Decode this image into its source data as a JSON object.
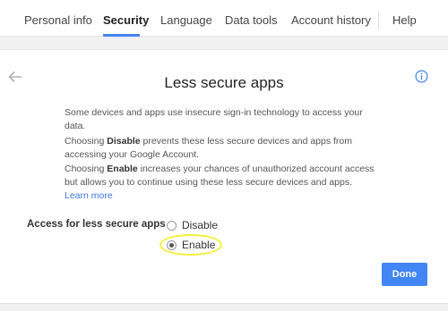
{
  "tabs": [
    {
      "label": "Personal info",
      "active": false
    },
    {
      "label": "Security",
      "active": true
    },
    {
      "label": "Language",
      "active": false
    },
    {
      "label": "Data tools",
      "active": false
    },
    {
      "label": "Account history",
      "active": false
    },
    {
      "label": "Help",
      "active": false
    }
  ],
  "accent_color": "#4285f4",
  "page": {
    "title": "Less secure apps",
    "back_icon": "arrow-left-icon",
    "info_icon": "info-circle-icon",
    "para1": "Some devices and apps use insecure sign-in technology to access your data.",
    "para2_prefix": "Choosing ",
    "para2_bold": "Disable",
    "para2_suffix": " prevents these less secure devices and apps from accessing your Google Account.",
    "para3_prefix": "Choosing ",
    "para3_bold": "Enable",
    "para3_suffix": " increases your chances of unauthorized account access but allows you to continue using these less secure devices and apps. ",
    "para3_link": "Learn more"
  },
  "access": {
    "label": "Access for less secure apps",
    "options": [
      {
        "label": "Disable",
        "selected": false
      },
      {
        "label": "Enable",
        "selected": true
      }
    ],
    "highlight_color": "#f5ef3a"
  },
  "done_label": "Done"
}
